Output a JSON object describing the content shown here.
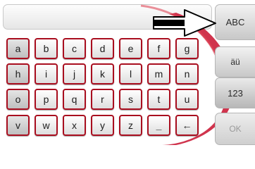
{
  "keyboard": {
    "rows": [
      [
        "a",
        "b",
        "c",
        "d",
        "e",
        "f",
        "g"
      ],
      [
        "h",
        "i",
        "j",
        "k",
        "l",
        "m",
        "n"
      ],
      [
        "o",
        "p",
        "q",
        "r",
        "s",
        "t",
        "u"
      ],
      [
        "v",
        "w",
        "x",
        "y",
        "z",
        "_",
        "←"
      ]
    ]
  },
  "side_buttons": {
    "abc": "ABC",
    "umlaut": "äü",
    "numbers": "123",
    "ok": "OK"
  },
  "colors": {
    "key_border": "#a90e1f",
    "swoosh": "#c8102e"
  },
  "icons": {
    "space": "underscore-glyph",
    "backspace": "left-arrow-icon",
    "pointer": "right-arrow-icon"
  }
}
